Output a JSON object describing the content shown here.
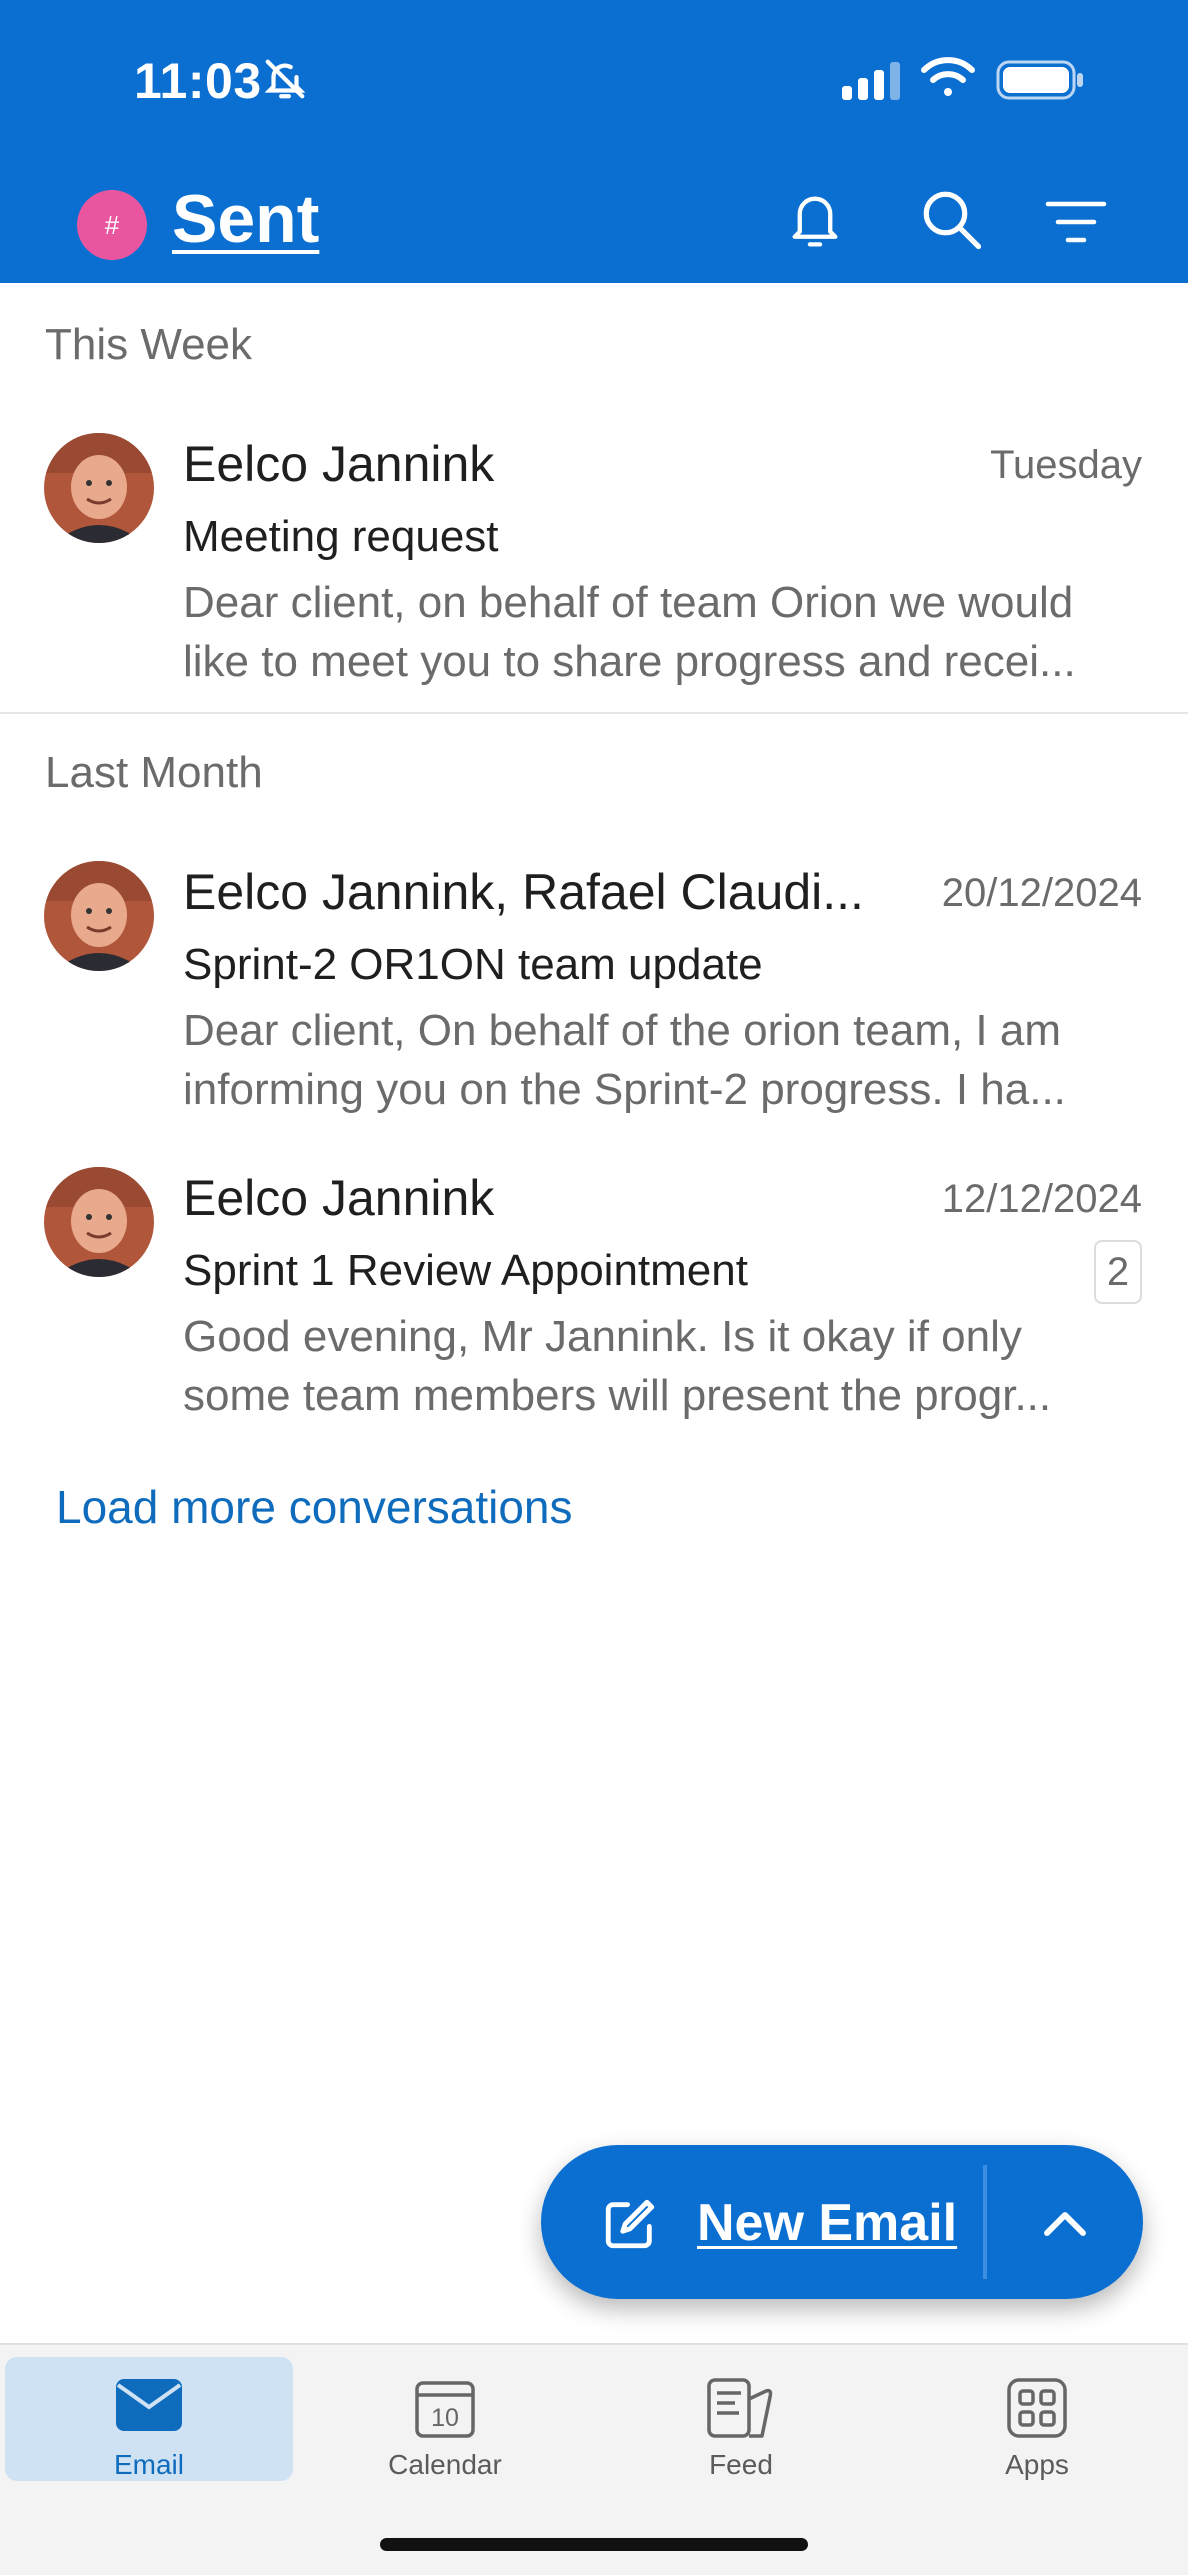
{
  "status_bar": {
    "time": "11:03"
  },
  "header": {
    "folder_title": "Sent",
    "account_badge": "#"
  },
  "sections": [
    {
      "heading": "This Week",
      "emails": [
        {
          "sender": "Eelco Jannink",
          "date": "Tuesday",
          "subject": "Meeting request",
          "preview_line1": "Dear client, on behalf of team Orion we would",
          "preview_line2": "like to meet you to share progress and recei..."
        }
      ]
    },
    {
      "heading": "Last Month",
      "emails": [
        {
          "sender": "Eelco Jannink, Rafael Claudi...",
          "date": "20/12/2024",
          "subject": "Sprint-2 OR1ON team update",
          "preview_line1": "Dear client, On behalf of the orion team, I am",
          "preview_line2": "informing you on the Sprint-2 progress. I ha..."
        },
        {
          "sender": "Eelco Jannink",
          "date": "12/12/2024",
          "subject": "Sprint 1 Review Appointment",
          "count": "2",
          "preview_line1": "Good evening, Mr Jannink. Is it okay if only",
          "preview_line2": "some team members will present the progr..."
        }
      ]
    }
  ],
  "load_more": "Load more conversations",
  "fab": {
    "label": "New Email"
  },
  "tabs": [
    {
      "label": "Email",
      "active": true
    },
    {
      "label": "Calendar",
      "day": "10"
    },
    {
      "label": "Feed"
    },
    {
      "label": "Apps"
    }
  ],
  "colors": {
    "brand": "#0a6fd1",
    "link": "#0f6cbd",
    "account_badge": "#e9559e",
    "active_tab_bg": "#cfe2f4"
  }
}
